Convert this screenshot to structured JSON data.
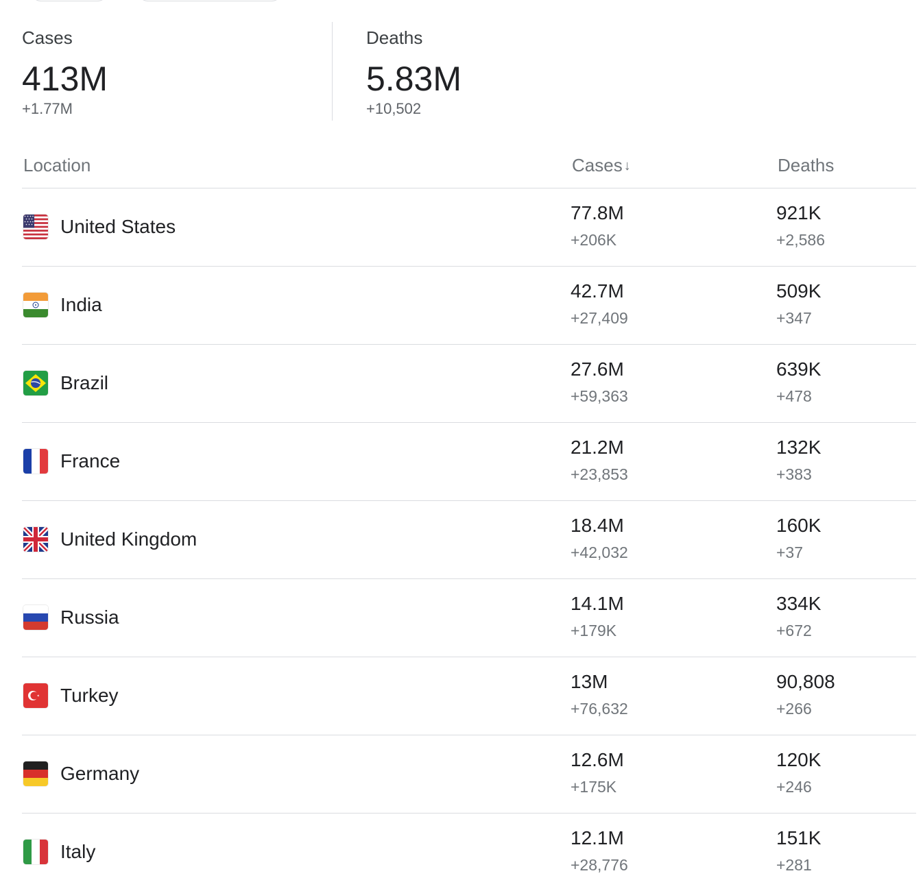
{
  "summary": {
    "cases": {
      "label": "Cases",
      "value": "413M",
      "delta": "+1.77M"
    },
    "deaths": {
      "label": "Deaths",
      "value": "5.83M",
      "delta": "+10,502"
    }
  },
  "table": {
    "headers": {
      "location": "Location",
      "cases": "Cases",
      "cases_sort": "↓",
      "deaths": "Deaths"
    },
    "rows": [
      {
        "flag": "us-flag-icon",
        "name": "United States",
        "cases": "77.8M",
        "cases_delta": "+206K",
        "deaths": "921K",
        "deaths_delta": "+2,586"
      },
      {
        "flag": "india-flag-icon",
        "name": "India",
        "cases": "42.7M",
        "cases_delta": "+27,409",
        "deaths": "509K",
        "deaths_delta": "+347"
      },
      {
        "flag": "brazil-flag-icon",
        "name": "Brazil",
        "cases": "27.6M",
        "cases_delta": "+59,363",
        "deaths": "639K",
        "deaths_delta": "+478"
      },
      {
        "flag": "france-flag-icon",
        "name": "France",
        "cases": "21.2M",
        "cases_delta": "+23,853",
        "deaths": "132K",
        "deaths_delta": "+383"
      },
      {
        "flag": "uk-flag-icon",
        "name": "United Kingdom",
        "cases": "18.4M",
        "cases_delta": "+42,032",
        "deaths": "160K",
        "deaths_delta": "+37"
      },
      {
        "flag": "russia-flag-icon",
        "name": "Russia",
        "cases": "14.1M",
        "cases_delta": "+179K",
        "deaths": "334K",
        "deaths_delta": "+672"
      },
      {
        "flag": "turkey-flag-icon",
        "name": "Turkey",
        "cases": "13M",
        "cases_delta": "+76,632",
        "deaths": "90,808",
        "deaths_delta": "+266"
      },
      {
        "flag": "germany-flag-icon",
        "name": "Germany",
        "cases": "12.6M",
        "cases_delta": "+175K",
        "deaths": "120K",
        "deaths_delta": "+246"
      },
      {
        "flag": "italy-flag-icon",
        "name": "Italy",
        "cases": "12.1M",
        "cases_delta": "+28,776",
        "deaths": "151K",
        "deaths_delta": "+281"
      }
    ]
  }
}
